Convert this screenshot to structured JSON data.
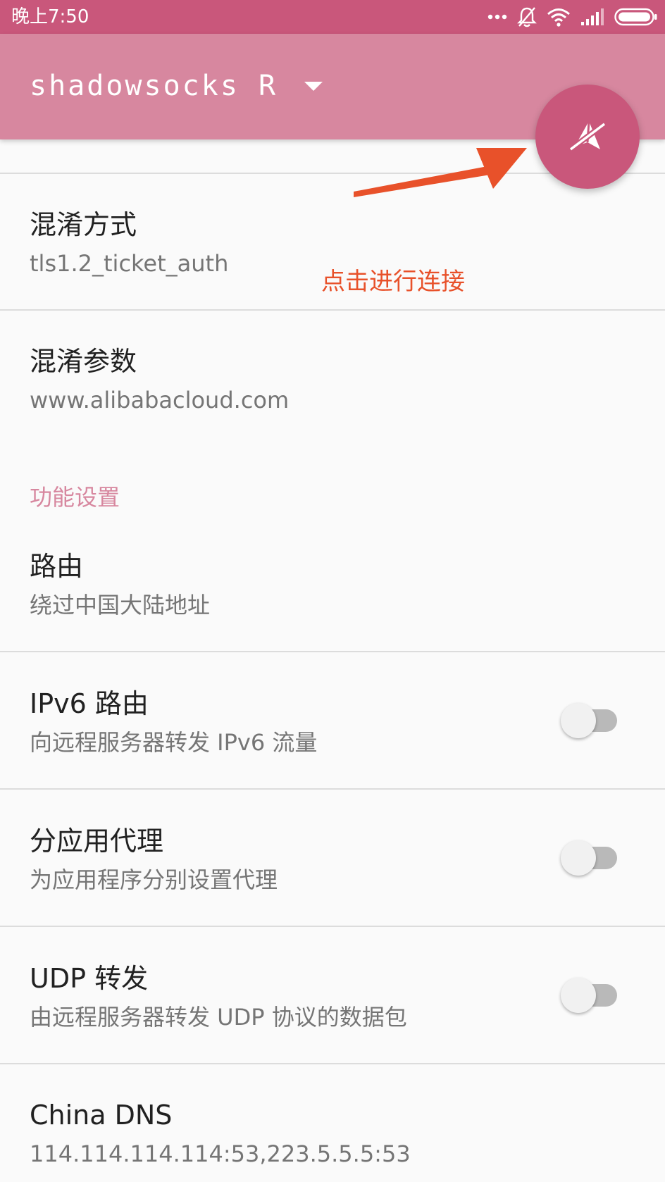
{
  "status_bar": {
    "time": "晚上7:50",
    "icons": [
      "more-dots-icon",
      "notifications-off-icon",
      "wifi-icon",
      "cellular-signal-icon",
      "battery-icon"
    ]
  },
  "app_bar": {
    "title": "shadowsocks R",
    "dropdown_icon": "chevron-down-icon"
  },
  "fab": {
    "icon": "paper-plane-off-icon",
    "state": "disconnected"
  },
  "annotation": {
    "text": "点击进行连接",
    "color": "#e8512a"
  },
  "settings": {
    "obfs": {
      "title": "混淆方式",
      "value": "tls1.2_ticket_auth"
    },
    "obfs_param": {
      "title": "混淆参数",
      "value": "www.alibabacloud.com"
    },
    "section_header": "功能设置",
    "route": {
      "title": "路由",
      "value": "绕过中国大陆地址"
    },
    "ipv6": {
      "title": "IPv6 路由",
      "summary": "向远程服务器转发 IPv6 流量",
      "enabled": false
    },
    "per_app_proxy": {
      "title": "分应用代理",
      "summary": "为应用程序分别设置代理",
      "enabled": false
    },
    "udp": {
      "title": "UDP 转发",
      "summary": "由远程服务器转发 UDP 协议的数据包",
      "enabled": false
    },
    "china_dns": {
      "title": "China DNS",
      "value": "114.114.114.114:53,223.5.5.5:53"
    }
  },
  "colors": {
    "status_bar": "#c9577b",
    "app_bar": "#d7879f",
    "fab": "#c9577b",
    "accent": "#d7879f",
    "annotation": "#e8512a"
  }
}
